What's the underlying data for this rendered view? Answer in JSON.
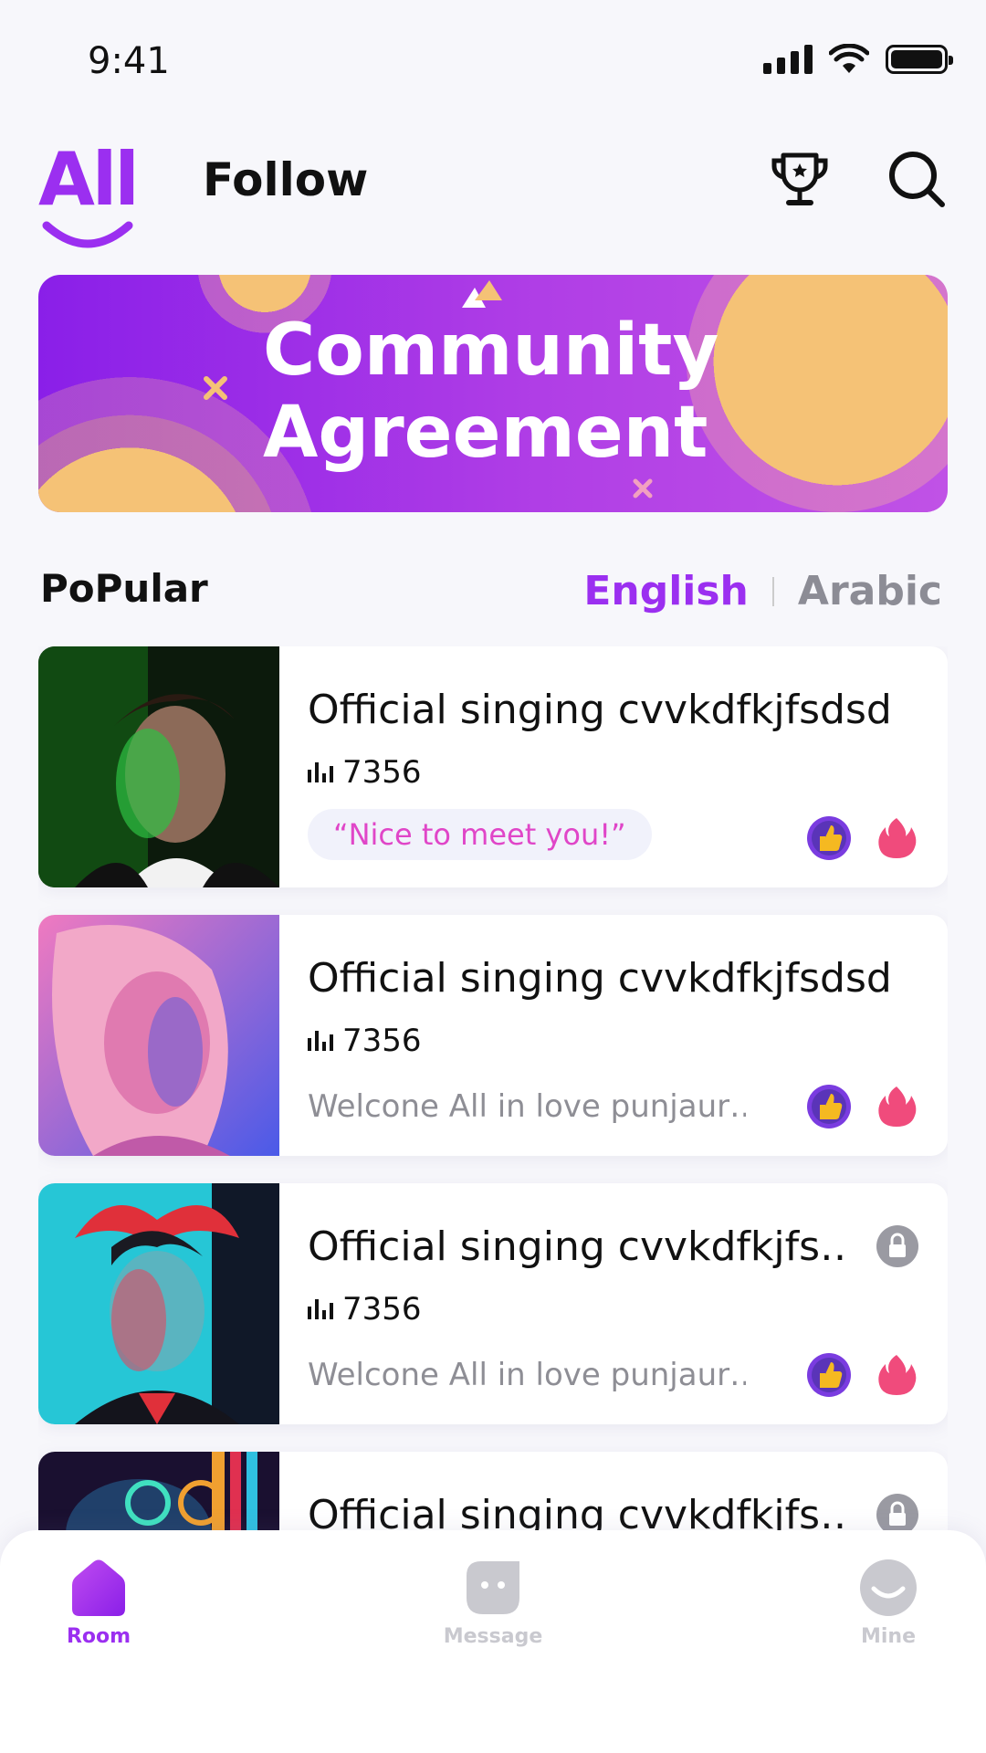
{
  "status_bar": {
    "time": "9:41"
  },
  "header": {
    "tab_all": "All",
    "tab_follow": "Follow"
  },
  "banner": {
    "title_line1": "Community",
    "title_line2": "Agreement"
  },
  "popular": {
    "title": "PoPular",
    "languages": [
      "English",
      "Arabic"
    ],
    "active_language": "English"
  },
  "rooms": [
    {
      "title": "Official singing cvvkdfkjfsdsdd",
      "listeners": "7356",
      "tag": "“Nice to meet you!”",
      "locked": false
    },
    {
      "title": "Official singing cvvkdfkjfsdsdd",
      "listeners": "7356",
      "desc": "Welcone All in love punjaur…",
      "locked": false
    },
    {
      "title": "Official singing cvvkdfkjfs…",
      "listeners": "7356",
      "desc": "Welcone All in love punjaur…",
      "locked": true
    },
    {
      "title": "Official singing cvvkdfkjfs…",
      "locked": true
    }
  ],
  "bottom_nav": {
    "items": [
      {
        "label": "Room",
        "icon": "home-icon",
        "active": true
      },
      {
        "label": "Message",
        "icon": "message-icon",
        "active": false
      },
      {
        "label": "Mine",
        "icon": "profile-icon",
        "active": false
      }
    ]
  },
  "colors": {
    "accent": "#9b2ff0",
    "pink": "#e046c8",
    "banner_start": "#8a1fe8",
    "banner_end": "#c052e6"
  }
}
